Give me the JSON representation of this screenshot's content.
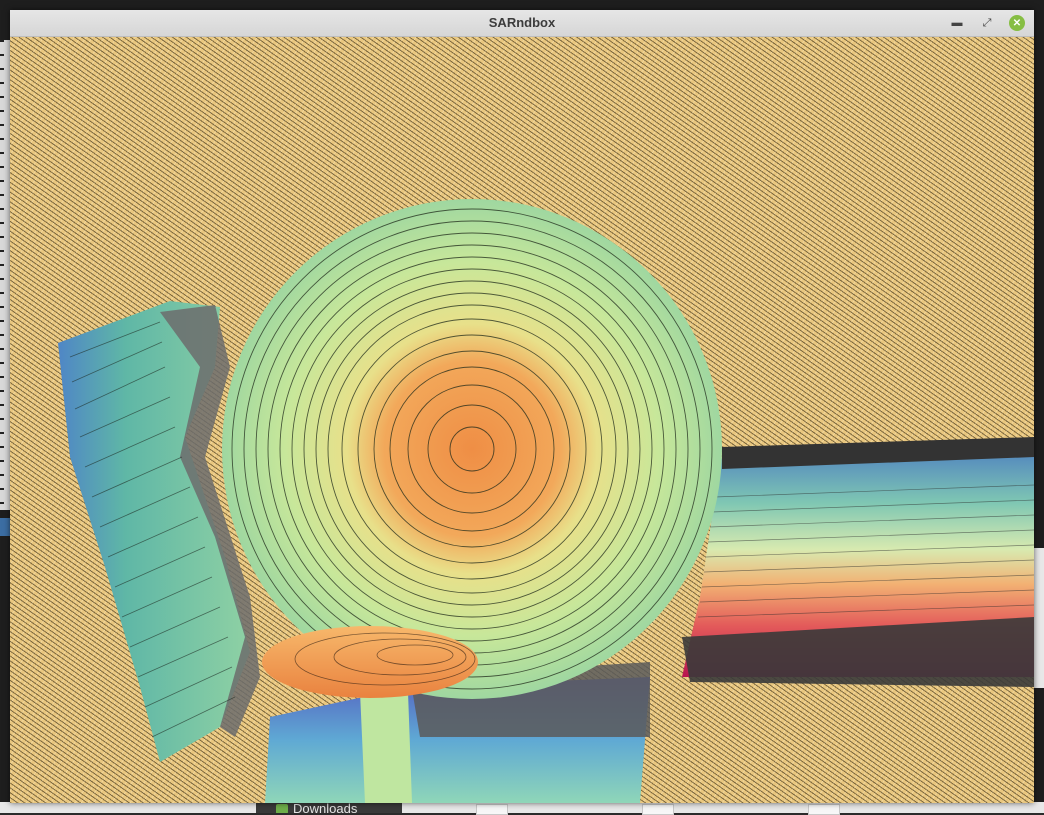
{
  "window": {
    "title": "SARndbox"
  },
  "titlebar_buttons": {
    "minimize_icon": "minimize-icon",
    "maximize_icon": "maximize-icon",
    "close_icon": "close-icon"
  },
  "taskbar": {
    "downloads_label": "Downloads"
  },
  "colors": {
    "sand": "#e9c77f",
    "peak": "#f0a055",
    "mid": "#d9e88a",
    "low": "#6fbf9a",
    "water": "#5b8fc9",
    "deep": "#c2185b",
    "close_button": "#86be43"
  }
}
